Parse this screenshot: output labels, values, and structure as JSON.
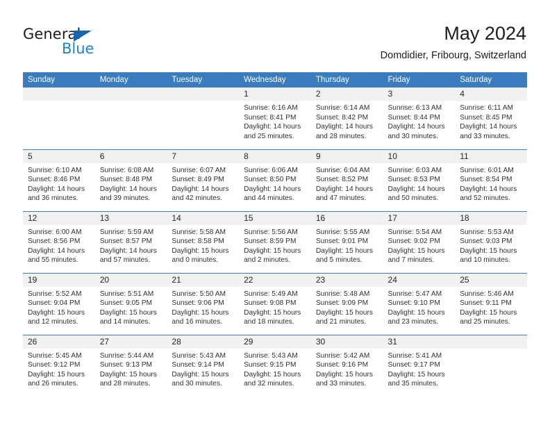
{
  "brand": {
    "name_part1": "General",
    "name_part2": "Blue",
    "triangle_color": "#1565b0",
    "blue_color": "#2180d4"
  },
  "header": {
    "title": "May 2024",
    "subtitle": "Domdidier, Fribourg, Switzerland",
    "accent_color": "#3a7cbe",
    "daynum_band_color": "#f1f1f1"
  },
  "weekday_headers": [
    "Sunday",
    "Monday",
    "Tuesday",
    "Wednesday",
    "Thursday",
    "Friday",
    "Saturday"
  ],
  "labels": {
    "sunrise": "Sunrise:",
    "sunset": "Sunset:",
    "daylight": "Daylight:"
  },
  "weeks": [
    [
      {
        "day": "",
        "empty": true
      },
      {
        "day": "",
        "empty": true
      },
      {
        "day": "",
        "empty": true
      },
      {
        "day": "1",
        "sunrise": "Sunrise: 6:16 AM",
        "sunset": "Sunset: 8:41 PM",
        "daylight": "Daylight: 14 hours and 25 minutes."
      },
      {
        "day": "2",
        "sunrise": "Sunrise: 6:14 AM",
        "sunset": "Sunset: 8:42 PM",
        "daylight": "Daylight: 14 hours and 28 minutes."
      },
      {
        "day": "3",
        "sunrise": "Sunrise: 6:13 AM",
        "sunset": "Sunset: 8:44 PM",
        "daylight": "Daylight: 14 hours and 30 minutes."
      },
      {
        "day": "4",
        "sunrise": "Sunrise: 6:11 AM",
        "sunset": "Sunset: 8:45 PM",
        "daylight": "Daylight: 14 hours and 33 minutes."
      }
    ],
    [
      {
        "day": "5",
        "sunrise": "Sunrise: 6:10 AM",
        "sunset": "Sunset: 8:46 PM",
        "daylight": "Daylight: 14 hours and 36 minutes."
      },
      {
        "day": "6",
        "sunrise": "Sunrise: 6:08 AM",
        "sunset": "Sunset: 8:48 PM",
        "daylight": "Daylight: 14 hours and 39 minutes."
      },
      {
        "day": "7",
        "sunrise": "Sunrise: 6:07 AM",
        "sunset": "Sunset: 8:49 PM",
        "daylight": "Daylight: 14 hours and 42 minutes."
      },
      {
        "day": "8",
        "sunrise": "Sunrise: 6:06 AM",
        "sunset": "Sunset: 8:50 PM",
        "daylight": "Daylight: 14 hours and 44 minutes."
      },
      {
        "day": "9",
        "sunrise": "Sunrise: 6:04 AM",
        "sunset": "Sunset: 8:52 PM",
        "daylight": "Daylight: 14 hours and 47 minutes."
      },
      {
        "day": "10",
        "sunrise": "Sunrise: 6:03 AM",
        "sunset": "Sunset: 8:53 PM",
        "daylight": "Daylight: 14 hours and 50 minutes."
      },
      {
        "day": "11",
        "sunrise": "Sunrise: 6:01 AM",
        "sunset": "Sunset: 8:54 PM",
        "daylight": "Daylight: 14 hours and 52 minutes."
      }
    ],
    [
      {
        "day": "12",
        "sunrise": "Sunrise: 6:00 AM",
        "sunset": "Sunset: 8:56 PM",
        "daylight": "Daylight: 14 hours and 55 minutes."
      },
      {
        "day": "13",
        "sunrise": "Sunrise: 5:59 AM",
        "sunset": "Sunset: 8:57 PM",
        "daylight": "Daylight: 14 hours and 57 minutes."
      },
      {
        "day": "14",
        "sunrise": "Sunrise: 5:58 AM",
        "sunset": "Sunset: 8:58 PM",
        "daylight": "Daylight: 15 hours and 0 minutes."
      },
      {
        "day": "15",
        "sunrise": "Sunrise: 5:56 AM",
        "sunset": "Sunset: 8:59 PM",
        "daylight": "Daylight: 15 hours and 2 minutes."
      },
      {
        "day": "16",
        "sunrise": "Sunrise: 5:55 AM",
        "sunset": "Sunset: 9:01 PM",
        "daylight": "Daylight: 15 hours and 5 minutes."
      },
      {
        "day": "17",
        "sunrise": "Sunrise: 5:54 AM",
        "sunset": "Sunset: 9:02 PM",
        "daylight": "Daylight: 15 hours and 7 minutes."
      },
      {
        "day": "18",
        "sunrise": "Sunrise: 5:53 AM",
        "sunset": "Sunset: 9:03 PM",
        "daylight": "Daylight: 15 hours and 10 minutes."
      }
    ],
    [
      {
        "day": "19",
        "sunrise": "Sunrise: 5:52 AM",
        "sunset": "Sunset: 9:04 PM",
        "daylight": "Daylight: 15 hours and 12 minutes."
      },
      {
        "day": "20",
        "sunrise": "Sunrise: 5:51 AM",
        "sunset": "Sunset: 9:05 PM",
        "daylight": "Daylight: 15 hours and 14 minutes."
      },
      {
        "day": "21",
        "sunrise": "Sunrise: 5:50 AM",
        "sunset": "Sunset: 9:06 PM",
        "daylight": "Daylight: 15 hours and 16 minutes."
      },
      {
        "day": "22",
        "sunrise": "Sunrise: 5:49 AM",
        "sunset": "Sunset: 9:08 PM",
        "daylight": "Daylight: 15 hours and 18 minutes."
      },
      {
        "day": "23",
        "sunrise": "Sunrise: 5:48 AM",
        "sunset": "Sunset: 9:09 PM",
        "daylight": "Daylight: 15 hours and 21 minutes."
      },
      {
        "day": "24",
        "sunrise": "Sunrise: 5:47 AM",
        "sunset": "Sunset: 9:10 PM",
        "daylight": "Daylight: 15 hours and 23 minutes."
      },
      {
        "day": "25",
        "sunrise": "Sunrise: 5:46 AM",
        "sunset": "Sunset: 9:11 PM",
        "daylight": "Daylight: 15 hours and 25 minutes."
      }
    ],
    [
      {
        "day": "26",
        "sunrise": "Sunrise: 5:45 AM",
        "sunset": "Sunset: 9:12 PM",
        "daylight": "Daylight: 15 hours and 26 minutes."
      },
      {
        "day": "27",
        "sunrise": "Sunrise: 5:44 AM",
        "sunset": "Sunset: 9:13 PM",
        "daylight": "Daylight: 15 hours and 28 minutes."
      },
      {
        "day": "28",
        "sunrise": "Sunrise: 5:43 AM",
        "sunset": "Sunset: 9:14 PM",
        "daylight": "Daylight: 15 hours and 30 minutes."
      },
      {
        "day": "29",
        "sunrise": "Sunrise: 5:43 AM",
        "sunset": "Sunset: 9:15 PM",
        "daylight": "Daylight: 15 hours and 32 minutes."
      },
      {
        "day": "30",
        "sunrise": "Sunrise: 5:42 AM",
        "sunset": "Sunset: 9:16 PM",
        "daylight": "Daylight: 15 hours and 33 minutes."
      },
      {
        "day": "31",
        "sunrise": "Sunrise: 5:41 AM",
        "sunset": "Sunset: 9:17 PM",
        "daylight": "Daylight: 15 hours and 35 minutes."
      },
      {
        "day": "",
        "empty": true
      }
    ]
  ]
}
